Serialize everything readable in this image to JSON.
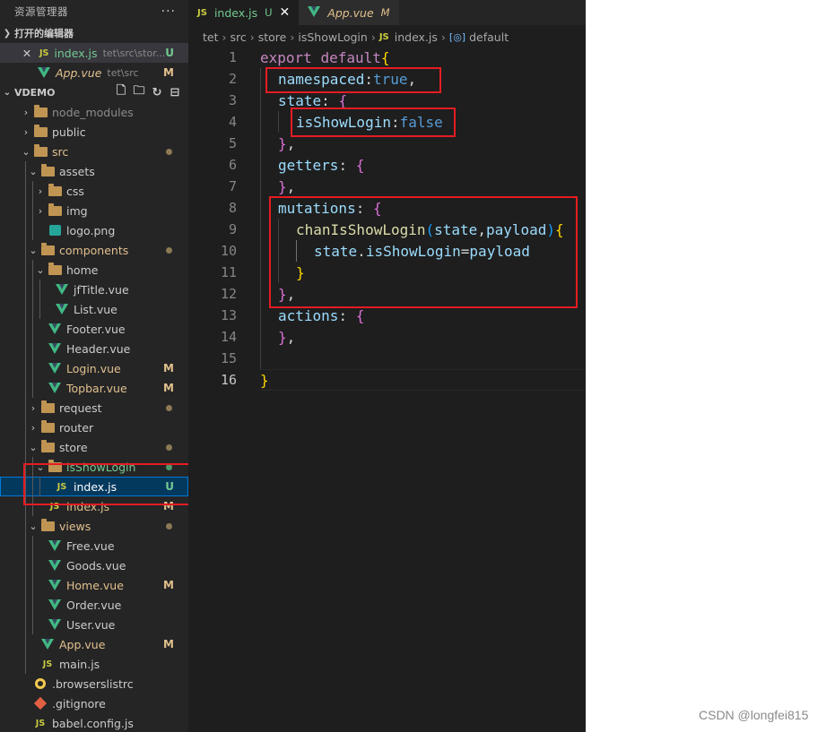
{
  "sidebar": {
    "title": "资源管理器",
    "more_icon": "ellipsis-icon",
    "open_editors": {
      "label": "打开的编辑器",
      "files": [
        {
          "name": "index.js",
          "path": "tet\\src\\stor...",
          "status": "U",
          "icon": "js-icon",
          "modified": true
        },
        {
          "name": "App.vue",
          "path": "tet\\src",
          "status": "M",
          "icon": "vue-icon",
          "modified": true
        }
      ]
    },
    "workspace": {
      "label": "VDEMO",
      "action_icons": [
        "new-file-icon",
        "new-folder-icon",
        "refresh-icon",
        "collapse-all-icon"
      ],
      "tree": [
        {
          "name": "node_modules",
          "type": "folder",
          "status": ""
        },
        {
          "name": "public",
          "type": "folder",
          "status": ""
        },
        {
          "name": "src",
          "type": "folder",
          "status": "dot"
        },
        {
          "name": "assets",
          "type": "folder",
          "status": ""
        },
        {
          "name": "css",
          "type": "folder",
          "status": ""
        },
        {
          "name": "img",
          "type": "folder",
          "status": ""
        },
        {
          "name": "logo.png",
          "type": "image",
          "status": ""
        },
        {
          "name": "components",
          "type": "folder",
          "status": "dot"
        },
        {
          "name": "home",
          "type": "folder",
          "status": ""
        },
        {
          "name": "jfTitle.vue",
          "type": "vue",
          "status": ""
        },
        {
          "name": "List.vue",
          "type": "vue",
          "status": ""
        },
        {
          "name": "Footer.vue",
          "type": "vue",
          "status": ""
        },
        {
          "name": "Header.vue",
          "type": "vue",
          "status": ""
        },
        {
          "name": "Login.vue",
          "type": "vue",
          "status": "M"
        },
        {
          "name": "Topbar.vue",
          "type": "vue",
          "status": "M"
        },
        {
          "name": "request",
          "type": "folder",
          "status": "dot"
        },
        {
          "name": "router",
          "type": "folder",
          "status": ""
        },
        {
          "name": "store",
          "type": "folder",
          "status": "dot"
        },
        {
          "name": "isShowLogin",
          "type": "folder",
          "status": "dot"
        },
        {
          "name": "index.js",
          "type": "js",
          "status": "U"
        },
        {
          "name": "index.js",
          "type": "js",
          "status": "M"
        },
        {
          "name": "views",
          "type": "folder",
          "status": "dot"
        },
        {
          "name": "Free.vue",
          "type": "vue",
          "status": ""
        },
        {
          "name": "Goods.vue",
          "type": "vue",
          "status": ""
        },
        {
          "name": "Home.vue",
          "type": "vue",
          "status": "M"
        },
        {
          "name": "Order.vue",
          "type": "vue",
          "status": ""
        },
        {
          "name": "User.vue",
          "type": "vue",
          "status": ""
        },
        {
          "name": "App.vue",
          "type": "vue",
          "status": "M"
        },
        {
          "name": "main.js",
          "type": "js",
          "status": ""
        },
        {
          "name": ".browserslistrc",
          "type": "config",
          "status": ""
        },
        {
          "name": ".gitignore",
          "type": "git",
          "status": ""
        },
        {
          "name": "babel.config.js",
          "type": "js",
          "status": ""
        }
      ]
    }
  },
  "editor": {
    "tabs": [
      {
        "name": "index.js",
        "status": "U",
        "icon_label": "JS",
        "active": true
      },
      {
        "name": "App.vue",
        "status": "M",
        "active": false
      }
    ],
    "breadcrumb": [
      "tet",
      "src",
      "store",
      "isShowLogin",
      "index.js",
      "default"
    ],
    "breadcrumb_icons": {
      "js": "JS",
      "object": "[◎]"
    },
    "code_lines": [
      {
        "num": "1",
        "text": "export default{"
      },
      {
        "num": "2",
        "text": "namespaced:true,"
      },
      {
        "num": "3",
        "text": "state: {"
      },
      {
        "num": "4",
        "text": "isShowLogin:false"
      },
      {
        "num": "5",
        "text": "},"
      },
      {
        "num": "6",
        "text": "getters: {"
      },
      {
        "num": "7",
        "text": "},"
      },
      {
        "num": "8",
        "text": "mutations: {"
      },
      {
        "num": "9",
        "text": "chanIsShowLogin(state,payload){"
      },
      {
        "num": "10",
        "text": "state.isShowLogin=payload"
      },
      {
        "num": "11",
        "text": "}"
      },
      {
        "num": "12",
        "text": "},"
      },
      {
        "num": "13",
        "text": "actions: {"
      },
      {
        "num": "14",
        "text": "},"
      },
      {
        "num": "15",
        "text": ""
      },
      {
        "num": "16",
        "text": "}"
      }
    ]
  },
  "watermark": "CSDN @longfei815",
  "colors": {
    "sidebar_bg": "#252526",
    "editor_bg": "#1e1e1e",
    "highlight_box": "#e51c23",
    "untracked_green": "#73c991",
    "modified_yellow": "#e2c08d"
  }
}
